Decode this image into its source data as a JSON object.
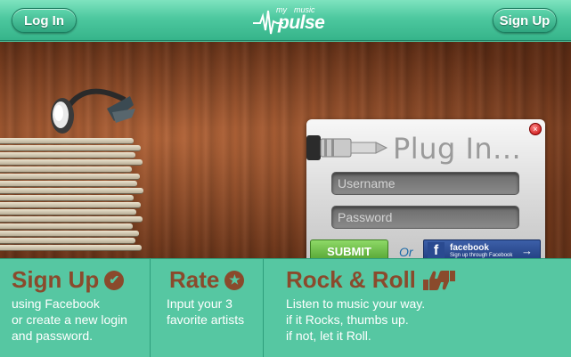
{
  "header": {
    "login_label": "Log In",
    "signup_label": "Sign Up",
    "logo": {
      "my": "my",
      "music": "music",
      "pulse": "pulse"
    }
  },
  "panel": {
    "title": "Plug In...",
    "username_placeholder": "Username",
    "password_placeholder": "Password",
    "submit_label": "SUBMIT",
    "or_text": "Or",
    "facebook": {
      "title": "facebook",
      "subtitle": "Sign up through Facebook"
    }
  },
  "steps": [
    {
      "title": "Sign Up",
      "icon": "check-circle-icon",
      "lines": [
        "using Facebook",
        "or create a new login",
        "and password."
      ]
    },
    {
      "title": "Rate",
      "icon": "star-circle-icon",
      "lines": [
        "Input your 3",
        "favorite artists"
      ]
    },
    {
      "title": "Rock & Roll",
      "icon": "thumbs-up-down-icon",
      "lines": [
        "Listen to music your way.",
        "if it Rocks, thumbs up.",
        "if not, let it Roll."
      ]
    }
  ],
  "colors": {
    "header_green": "#4dc89f",
    "steps_green": "#56c7a2",
    "steps_title_brown": "#8a4a2c",
    "submit_green": "#6bbf47",
    "facebook_blue": "#2d4e92"
  }
}
